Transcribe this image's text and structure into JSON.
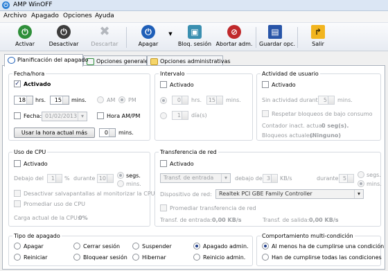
{
  "window": {
    "title": "AMP WinOFF"
  },
  "menu": [
    "Archivo",
    "Apagado",
    "Opciones",
    "Ayuda"
  ],
  "toolbar": {
    "activar": "Activar",
    "desactivar": "Desactivar",
    "descartar": "Descartar",
    "apagar": "Apagar",
    "bloq_sesion": "Bloq. sesión",
    "abortar": "Abortar adm.",
    "guardar": "Guardar opc.",
    "salir": "Salir"
  },
  "tabs": [
    "Planificación del apagado",
    "Opciones generales",
    "Opciones administrativas"
  ],
  "fecha_hora": {
    "title": "Fecha/hora",
    "activado": "Activado",
    "hours": "18",
    "hrs_label": "hrs.",
    "minutes": "15",
    "mins_label": "mins.",
    "am": "AM",
    "pm": "PM",
    "fecha_label": "Fecha:",
    "fecha_value": "01/02/2013",
    "hora_ampm": "Hora AM/PM",
    "usar_hora_btn": "Usar la hora actual más",
    "extra_mins": "0",
    "extra_mins_label": "mins."
  },
  "intervalo": {
    "title": "Intervalo",
    "activado": "Activado",
    "hrs_value": "0",
    "hrs_label": "hrs.",
    "mins_value": "15",
    "mins_label": "mins.",
    "dias_value": "1",
    "dias_label": "día(s)"
  },
  "actividad": {
    "title": "Actividad de usuario",
    "activado": "Activado",
    "sin_actividad": "Sin actividad durante",
    "sin_actividad_value": "5",
    "mins_label": "mins.",
    "respetar": "Respetar bloqueos de bajo consumo",
    "contador_label": "Contador inact. actual:",
    "contador_value": "0 seg(s).",
    "bloqueos_label": "Bloqueos actuales:",
    "bloqueos_value": "(Ninguno)"
  },
  "cpu": {
    "title": "Uso de CPU",
    "activado": "Activado",
    "debajo_label": "Debajo del",
    "debajo_value": "1",
    "percent": "%",
    "durante_label": "durante",
    "durante_value": "10",
    "segs": "segs.",
    "mins": "mins.",
    "desactivar_salvapantallas": "Desactivar salvapantallas al monitorizar la CPU",
    "promediar": "Promediar uso de CPU",
    "carga_label": "Carga actual de la CPU:",
    "carga_value": "0%"
  },
  "red": {
    "title": "Transferencia de red",
    "activado": "Activado",
    "transf_combo": "Transf. de entrada",
    "debajo_label": "debajo de",
    "debajo_value": "3",
    "kbs": "KB/s",
    "durante_label": "durante",
    "durante_value": "5",
    "segs": "segs.",
    "mins": "mins.",
    "dispositivo_label": "Dispositivo de red:",
    "dispositivo_value": "Realtek PCI GBE Family Controller",
    "promediar": "Promediar transferencia de red",
    "entrada_label": "Transf. de entrada:",
    "entrada_value": "0,00 KB/s",
    "salida_label": "Transf. de salida:",
    "salida_value": "0,00 KB/s"
  },
  "tipo_apagado": {
    "title": "Tipo de apagado",
    "options": [
      "Apagar",
      "Cerrar sesión",
      "Suspender",
      "Apagado admin.",
      "Reiniciar",
      "Bloquear sesión",
      "Hibernar",
      "Reinicio admin."
    ],
    "selected": "Apagado admin."
  },
  "multi": {
    "title": "Comportamiento multi-condición",
    "opt1": "Al menos ha de cumplirse una condición",
    "opt2": "Han de cumplirse todas las condiciones",
    "selected": "Al menos ha de cumplirse una condición"
  },
  "colors": {
    "activar_icon": "#2f8f3a",
    "apagar_icon": "#1f5fb8",
    "abortar_icon": "#c0292b",
    "titlebar": "#dbe6f4"
  }
}
